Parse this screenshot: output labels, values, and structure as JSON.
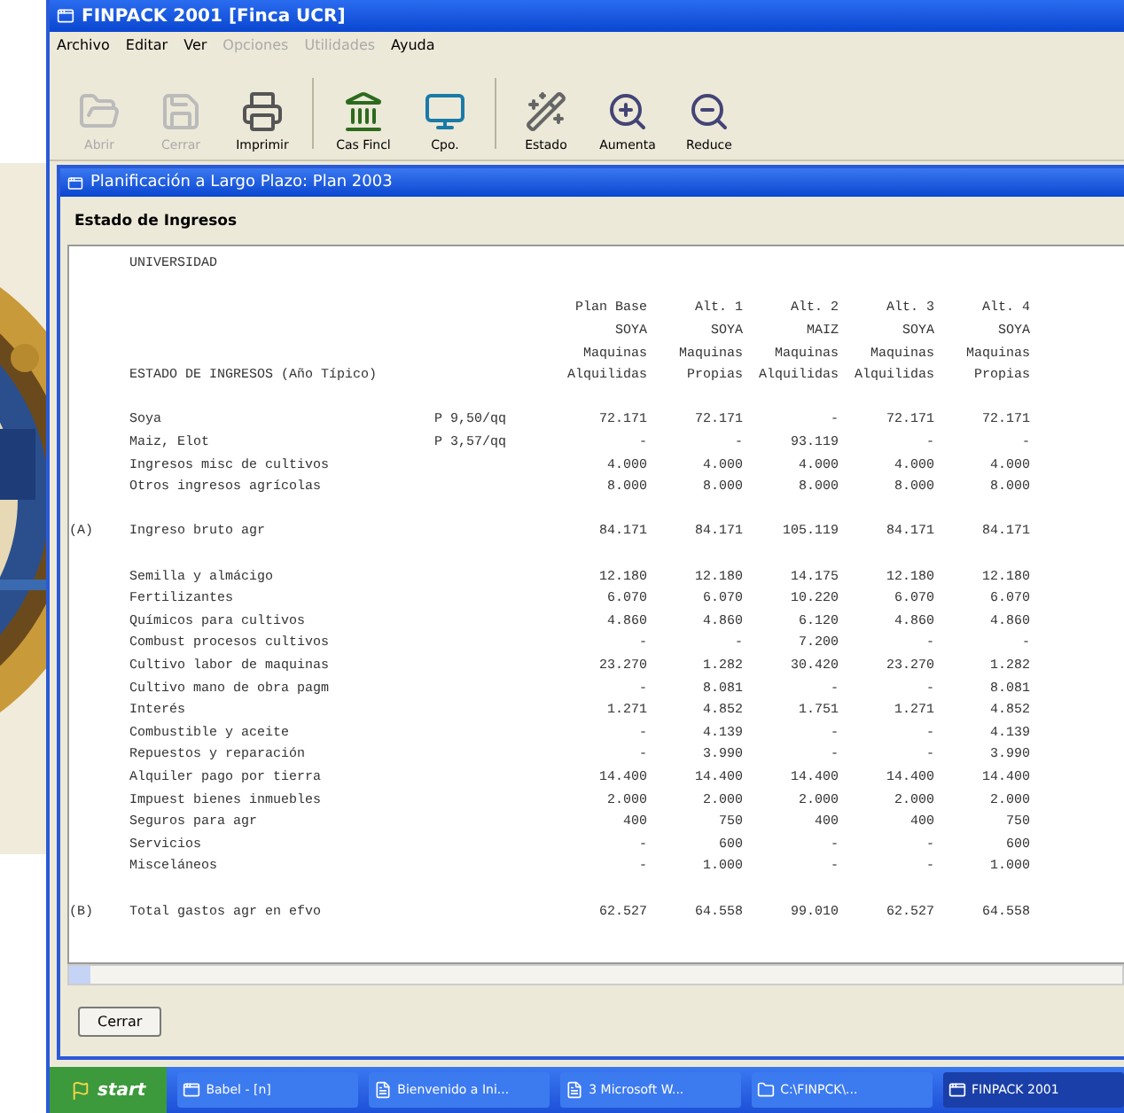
{
  "window": {
    "title": "FINPACK 2001 [Finca UCR]"
  },
  "menu": [
    {
      "label": "Archivo",
      "disabled": false
    },
    {
      "label": "Editar",
      "disabled": false
    },
    {
      "label": "Ver",
      "disabled": false
    },
    {
      "label": "Opciones",
      "disabled": true
    },
    {
      "label": "Utilidades",
      "disabled": true
    },
    {
      "label": "Ayuda",
      "disabled": false
    }
  ],
  "toolbar": [
    {
      "label": "Abrir",
      "kind": "folder",
      "disabled": true
    },
    {
      "label": "Cerrar",
      "kind": "save",
      "disabled": true
    },
    {
      "label": "Imprimir",
      "kind": "printer",
      "disabled": false,
      "separator_after": true
    },
    {
      "label": "Cas Fincl",
      "kind": "bank",
      "disabled": false
    },
    {
      "label": "Cpo.",
      "kind": "monitor",
      "disabled": false,
      "separator_after": true
    },
    {
      "label": "Estado",
      "kind": "wand",
      "disabled": false
    },
    {
      "label": "Aumenta",
      "kind": "zoom-in",
      "disabled": false
    },
    {
      "label": "Reduce",
      "kind": "zoom-out",
      "disabled": false
    }
  ],
  "child_window": {
    "title": "Planificación a Largo Plazo: Plan 2003",
    "heading": "Estado de Ingresos",
    "report": {
      "title": "UNIVERSIDAD",
      "subtitle": "ESTADO DE INGRESOS (Año Típico)",
      "columns": [
        {
          "lines": [
            "Plan Base",
            "SOYA",
            "Maquinas",
            "Alquilidas"
          ]
        },
        {
          "lines": [
            "Alt. 1",
            "SOYA",
            "Maquinas",
            "Propias"
          ]
        },
        {
          "lines": [
            "Alt. 2",
            "MAIZ",
            "Maquinas",
            "Alquilidas"
          ]
        },
        {
          "lines": [
            "Alt. 3",
            "SOYA",
            "Maquinas",
            "Alquilidas"
          ]
        },
        {
          "lines": [
            "Alt. 4",
            "SOYA",
            "Maquinas",
            "Propias"
          ]
        }
      ],
      "sections": [
        {
          "rows": [
            {
              "label": "Soya",
              "price": "P 9,50/qq",
              "values": [
                "72.171",
                "72.171",
                "-",
                "72.171",
                "72.171"
              ]
            },
            {
              "label": "Maiz, Elot",
              "price": "P 3,57/qq",
              "values": [
                "-",
                "-",
                "93.119",
                "-",
                "-"
              ]
            },
            {
              "label": "Ingresos misc de cultivos",
              "values": [
                "4.000",
                "4.000",
                "4.000",
                "4.000",
                "4.000"
              ]
            },
            {
              "label": "Otros ingresos agrícolas",
              "values": [
                "8.000",
                "8.000",
                "8.000",
                "8.000",
                "8.000"
              ]
            }
          ]
        },
        {
          "rows": [
            {
              "marker": "(A)",
              "label": "Ingreso bruto agr",
              "values": [
                "84.171",
                "84.171",
                "105.119",
                "84.171",
                "84.171"
              ]
            }
          ]
        },
        {
          "rows": [
            {
              "label": "Semilla y almácigo",
              "values": [
                "12.180",
                "12.180",
                "14.175",
                "12.180",
                "12.180"
              ]
            },
            {
              "label": "Fertilizantes",
              "values": [
                "6.070",
                "6.070",
                "10.220",
                "6.070",
                "6.070"
              ]
            },
            {
              "label": "Químicos para cultivos",
              "values": [
                "4.860",
                "4.860",
                "6.120",
                "4.860",
                "4.860"
              ]
            },
            {
              "label": "Combust procesos cultivos",
              "values": [
                "-",
                "-",
                "7.200",
                "-",
                "-"
              ]
            },
            {
              "label": "Cultivo labor de maquinas",
              "values": [
                "23.270",
                "1.282",
                "30.420",
                "23.270",
                "1.282"
              ]
            },
            {
              "label": "Cultivo mano de obra pagm",
              "values": [
                "-",
                "8.081",
                "-",
                "-",
                "8.081"
              ]
            },
            {
              "label": "Interés",
              "values": [
                "1.271",
                "4.852",
                "1.751",
                "1.271",
                "4.852"
              ]
            },
            {
              "label": "Combustible y aceite",
              "values": [
                "-",
                "4.139",
                "-",
                "-",
                "4.139"
              ]
            },
            {
              "label": "Repuestos y reparación",
              "values": [
                "-",
                "3.990",
                "-",
                "-",
                "3.990"
              ]
            },
            {
              "label": "Alquiler pago por tierra",
              "values": [
                "14.400",
                "14.400",
                "14.400",
                "14.400",
                "14.400"
              ]
            },
            {
              "label": "Impuest bienes inmuebles",
              "values": [
                "2.000",
                "2.000",
                "2.000",
                "2.000",
                "2.000"
              ]
            },
            {
              "label": "Seguros para agr",
              "values": [
                "400",
                "750",
                "400",
                "400",
                "750"
              ]
            },
            {
              "label": "Servicios",
              "values": [
                "-",
                "600",
                "-",
                "-",
                "600"
              ]
            },
            {
              "label": "Misceláneos",
              "values": [
                "-",
                "1.000",
                "-",
                "-",
                "1.000"
              ]
            }
          ]
        },
        {
          "rows": [
            {
              "marker": "(B)",
              "label": "Total gastos agr en efvo",
              "values": [
                "62.527",
                "64.558",
                "99.010",
                "62.527",
                "64.558"
              ]
            }
          ]
        }
      ]
    },
    "close_button": "Cerrar"
  },
  "taskbar": {
    "start": "start",
    "tasks": [
      {
        "label": "Babel - [n]",
        "kind": "app",
        "selected": false
      },
      {
        "label": "Bienvenido a Ini...",
        "kind": "document",
        "selected": false
      },
      {
        "label": "3 Microsoft W...",
        "kind": "word",
        "selected": false
      },
      {
        "label": "C:\\FINPCK\\...",
        "kind": "folder",
        "selected": false
      },
      {
        "label": "FINPACK 2001",
        "kind": "app",
        "selected": true
      }
    ]
  }
}
